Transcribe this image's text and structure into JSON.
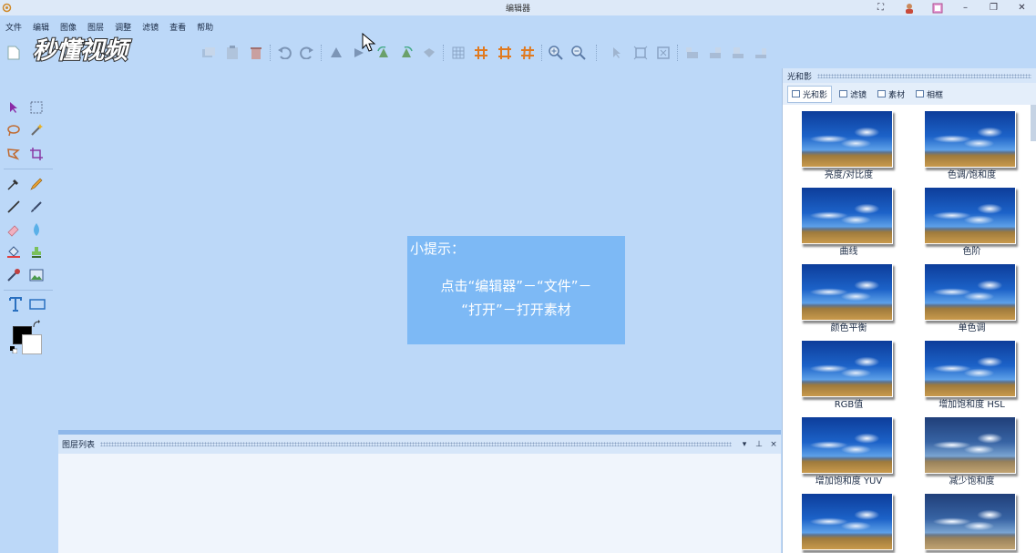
{
  "window": {
    "title": "编辑器"
  },
  "menu": [
    "文件",
    "编辑",
    "图像",
    "图层",
    "调整",
    "滤镜",
    "查看",
    "帮助"
  ],
  "watermark": {
    "text": "秒懂视频"
  },
  "tip": {
    "title": "小提示：",
    "line1": "点击“编辑器”－“文件”－",
    "line2": "“打开”－打开素材"
  },
  "layer_panel": {
    "title": "图层列表",
    "ctrl_dropdown": "▾",
    "ctrl_pin": "⊥",
    "ctrl_close": "×"
  },
  "right_panel": {
    "title": "光和影",
    "tabs": [
      "光和影",
      "滤镜",
      "素材",
      "相框"
    ],
    "effects": [
      "亮度/对比度",
      "色调/饱和度",
      "曲线",
      "色阶",
      "颜色平衡",
      "单色调",
      "RGB值",
      "增加饱和度 HSL",
      "增加饱和度 YUV",
      "减少饱和度",
      "",
      ""
    ]
  },
  "colors": {
    "accent": "#7db9f5",
    "background": "#bcd8f8",
    "foreground_color": "#000000",
    "background_color": "#ffffff"
  }
}
